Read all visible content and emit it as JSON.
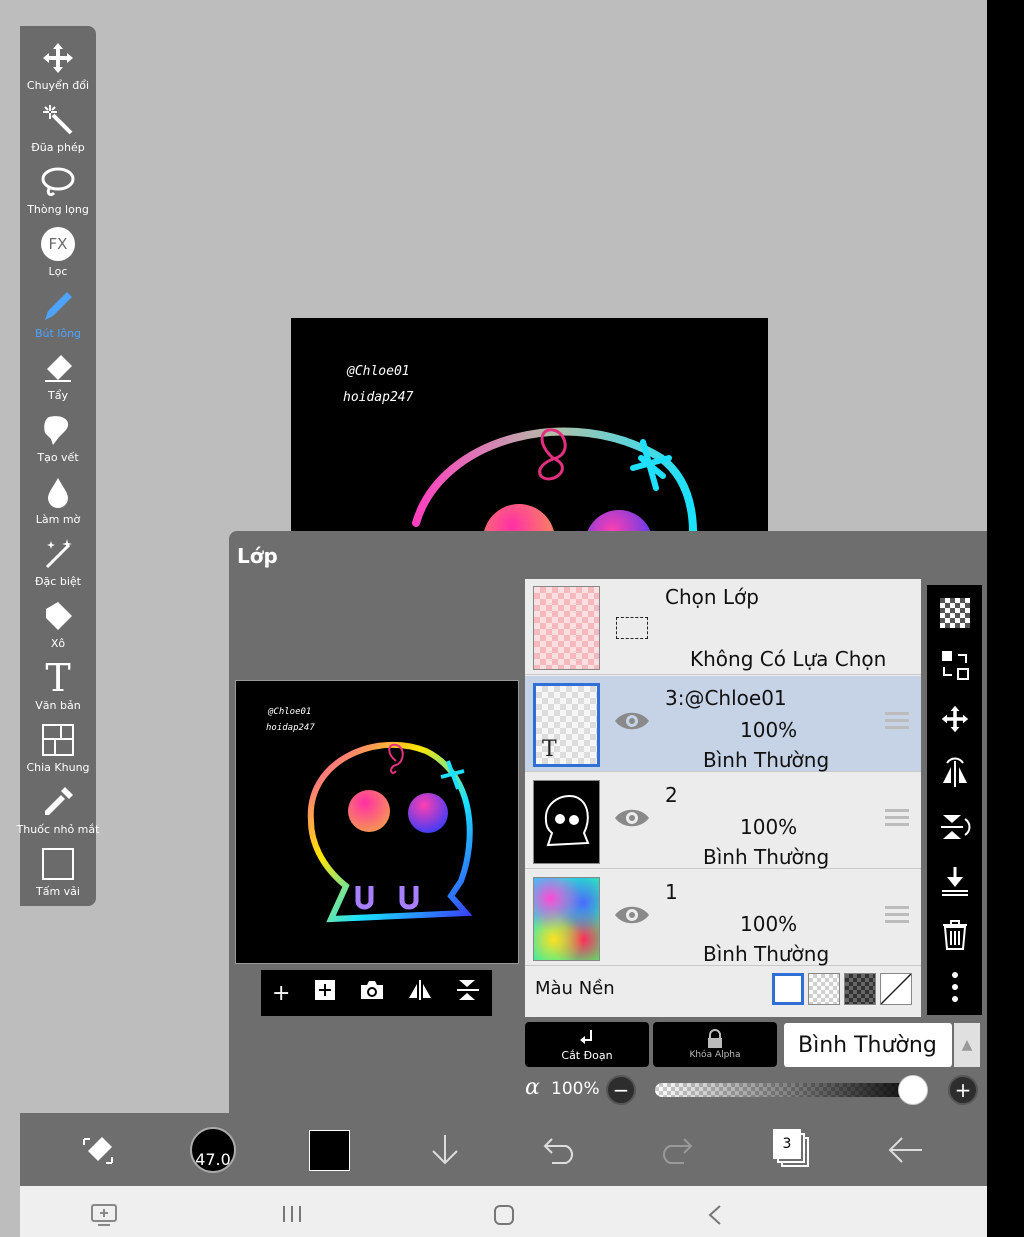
{
  "toolbar": {
    "tools": [
      {
        "label": "Chuyển đổi",
        "icon": "move-icon"
      },
      {
        "label": "Đũa phép",
        "icon": "magic-wand-icon"
      },
      {
        "label": "Thòng lọng",
        "icon": "lasso-icon"
      },
      {
        "label": "Lọc",
        "icon": "fx-filter-icon",
        "glyph": "FX"
      },
      {
        "label": "Bút lông",
        "icon": "brush-icon",
        "active": true
      },
      {
        "label": "Tẩy",
        "icon": "eraser-icon"
      },
      {
        "label": "Tạo vết",
        "icon": "smudge-icon"
      },
      {
        "label": "Làm mờ",
        "icon": "blur-icon"
      },
      {
        "label": "Đặc biệt",
        "icon": "special-icon"
      },
      {
        "label": "Xô",
        "icon": "bucket-icon"
      },
      {
        "label": "Văn bản",
        "icon": "text-icon",
        "glyph": "T"
      },
      {
        "label": "Chia Khung",
        "icon": "frame-divider-icon"
      },
      {
        "label": "Thuốc nhỏ mắt",
        "icon": "eyedropper-icon"
      },
      {
        "label": "Tấm vải",
        "icon": "canvas-icon"
      }
    ]
  },
  "artwork": {
    "watermark_line1": "@Chloe01",
    "watermark_line2": "hoidap247"
  },
  "layer_panel": {
    "title": "Lớp",
    "select_layer": {
      "title": "Chọn Lớp",
      "status": "Không Có Lựa Chọn"
    },
    "layers": [
      {
        "name": "3:@Chloe01",
        "opacity": "100%",
        "mode": "Bình Thường",
        "selected": true,
        "thumb_glyph": "T"
      },
      {
        "name": "2",
        "opacity": "100%",
        "mode": "Bình Thường",
        "selected": false
      },
      {
        "name": "1",
        "opacity": "100%",
        "mode": "Bình Thường",
        "selected": false
      }
    ],
    "background_label": "Màu Nền",
    "clip_label": "Cắt Đoạn",
    "alpha_lock_label": "Khóa Alpha",
    "blend_mode": "Bình Thường",
    "alpha_symbol": "α",
    "alpha_value": "100%",
    "alpha_level": 0.95
  },
  "bottom_bar": {
    "brush_size": "47.0",
    "layer_count": "3",
    "current_color": "#000000"
  },
  "colors": {
    "accent": "#4ea3ff",
    "selected_row": "#c6d2e6",
    "selected_border": "#2f6fd6"
  }
}
